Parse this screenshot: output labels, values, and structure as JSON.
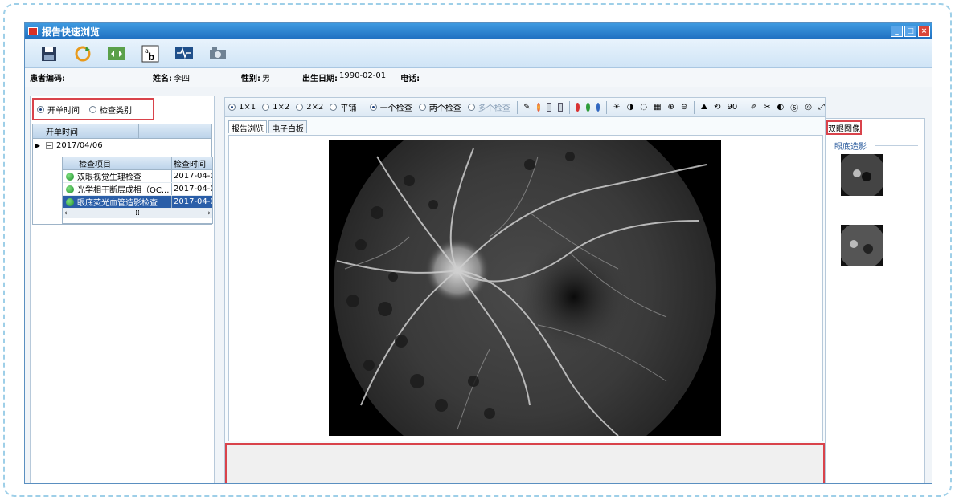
{
  "window": {
    "title": "报告快速浏览"
  },
  "toolbar": {
    "buttons": [
      "save-icon",
      "refresh-icon",
      "fit-icon",
      "text-icon",
      "monitor-icon",
      "camera-icon"
    ]
  },
  "patient": {
    "id_label": "患者编码:",
    "id_value": "",
    "name_label": "姓名:",
    "name_value": "李四",
    "sex_label": "性别:",
    "sex_value": "男",
    "birth_label": "出生日期:",
    "birth_value": "1990-02-01",
    "phone_label": "电话:",
    "phone_value": ""
  },
  "left": {
    "radio_open_time": "开单时间",
    "radio_exam_type": "检查类别",
    "tree_header": "开单时间",
    "tree_date": "2017/04/06",
    "grid_headers": [
      "检查项目",
      "检查时间"
    ],
    "rows": [
      {
        "item": "双眼视觉生理检查",
        "time": "2017-04-0"
      },
      {
        "item": "光学相干断层成相（OC...",
        "time": "2017-04-0"
      },
      {
        "item": "眼底荧光血管造影检查",
        "time": "2017-04-0"
      }
    ]
  },
  "center": {
    "layout_options": [
      "1×1",
      "1×2",
      "2×2",
      "平铺"
    ],
    "exam_options": [
      "一个检查",
      "两个检查",
      "多个检查"
    ],
    "rotate_value": "90",
    "tabs": [
      "报告浏览",
      "电子白板"
    ]
  },
  "right": {
    "tab_label": "双眼图像",
    "group_label": "眼底造影"
  },
  "colors": {
    "title_bar": "#1f6fc0",
    "highlight_red": "#d9434b",
    "selected_row": "#2a5ea8"
  }
}
